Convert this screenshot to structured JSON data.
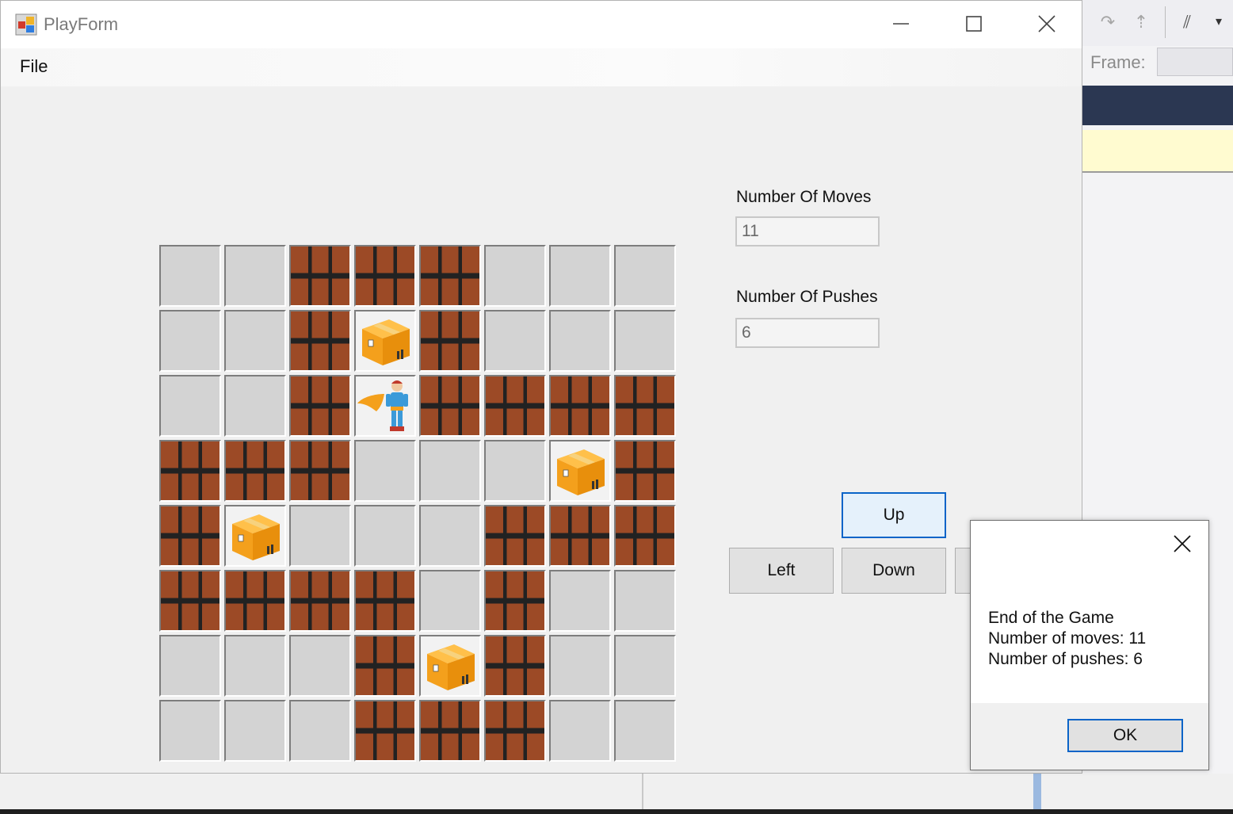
{
  "window": {
    "title": "PlayForm",
    "menu": {
      "file_label": "File"
    }
  },
  "stats": {
    "moves_label": "Number Of Moves",
    "moves_value": "11",
    "pushes_label": "Number Of Pushes",
    "pushes_value": "6"
  },
  "controls": {
    "up_label": "Up",
    "left_label": "Left",
    "down_label": "Down"
  },
  "board": {
    "rows": [
      [
        "floor",
        "floor",
        "wall",
        "wall",
        "wall",
        "floor",
        "floor",
        "floor"
      ],
      [
        "floor",
        "floor",
        "wall",
        "box",
        "wall",
        "floor",
        "floor",
        "floor"
      ],
      [
        "floor",
        "floor",
        "wall",
        "player",
        "wall",
        "wall",
        "wall",
        "wall"
      ],
      [
        "wall",
        "wall",
        "wall",
        "floor",
        "floor",
        "floor",
        "box",
        "wall"
      ],
      [
        "wall",
        "box",
        "floor",
        "floor",
        "floor",
        "wall",
        "wall",
        "wall"
      ],
      [
        "wall",
        "wall",
        "wall",
        "wall",
        "floor",
        "wall",
        "floor",
        "floor"
      ],
      [
        "floor",
        "floor",
        "floor",
        "wall",
        "box",
        "wall",
        "floor",
        "floor"
      ],
      [
        "floor",
        "floor",
        "floor",
        "wall",
        "wall",
        "wall",
        "floor",
        "floor"
      ]
    ]
  },
  "dialog": {
    "line1": "End of the Game",
    "line2": "Number of moves: 11",
    "line3": "Number of pushes: 6",
    "ok_label": "OK"
  },
  "background": {
    "frame_label": "Frame:"
  },
  "colors": {
    "accent": "#0a64c8",
    "brick": "#9c4a26",
    "box": "#f4a01c",
    "navy": "#2b3752"
  }
}
